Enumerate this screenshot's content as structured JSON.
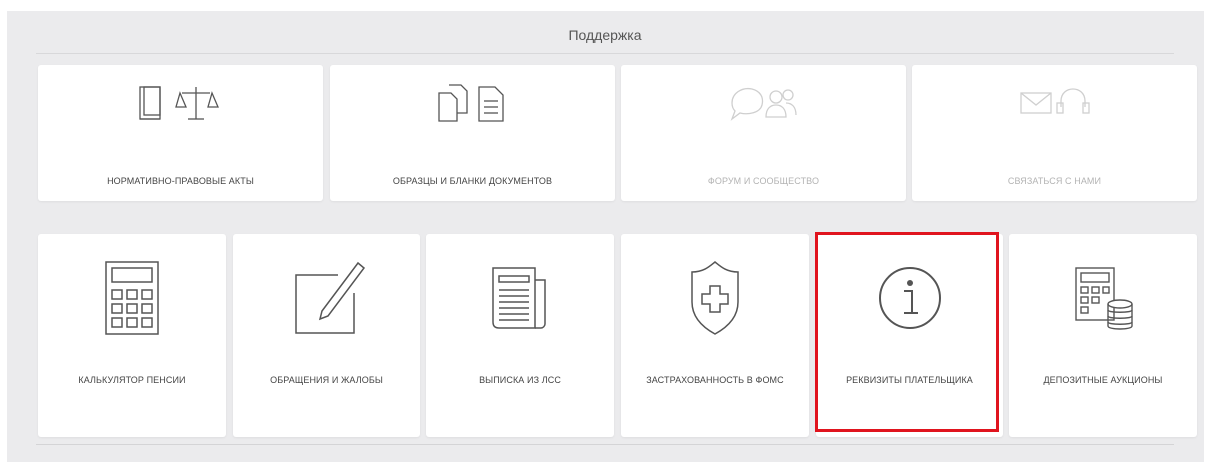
{
  "header": {
    "title": "Поддержка"
  },
  "row1": [
    {
      "label": "НОРМАТИВНО-ПРАВОВЫЕ АКТЫ",
      "icon": "book-scales-icon",
      "enabled": true
    },
    {
      "label": "ОБРАЗЦЫ И БЛАНКИ ДОКУМЕНТОВ",
      "icon": "documents-icon",
      "enabled": true
    },
    {
      "label": "ФОРУМ И СООБЩЕСТВО",
      "icon": "forum-icon",
      "enabled": false
    },
    {
      "label": "СВЯЗАТЬСЯ С НАМИ",
      "icon": "contact-icon",
      "enabled": false
    }
  ],
  "row2": [
    {
      "label": "КАЛЬКУЛЯТОР ПЕНСИИ",
      "icon": "calculator-icon"
    },
    {
      "label": "ОБРАЩЕНИЯ И ЖАЛОБЫ",
      "icon": "edit-note-icon"
    },
    {
      "label": "ВЫПИСКА ИЗ ЛСС",
      "icon": "newspaper-icon"
    },
    {
      "label": "ЗАСТРАХОВАННОСТЬ В ФОМС",
      "icon": "medical-shield-icon"
    },
    {
      "label": "РЕКВИЗИТЫ ПЛАТЕЛЬЩИКА",
      "icon": "info-icon"
    },
    {
      "label": "ДЕПОЗИТНЫЕ АУКЦИОНЫ",
      "icon": "calculator-coins-icon"
    }
  ],
  "colors": {
    "highlight": "#e0141e",
    "panel": "#ebebed",
    "icon": "#555555",
    "icon_disabled": "#cfcfcf"
  }
}
